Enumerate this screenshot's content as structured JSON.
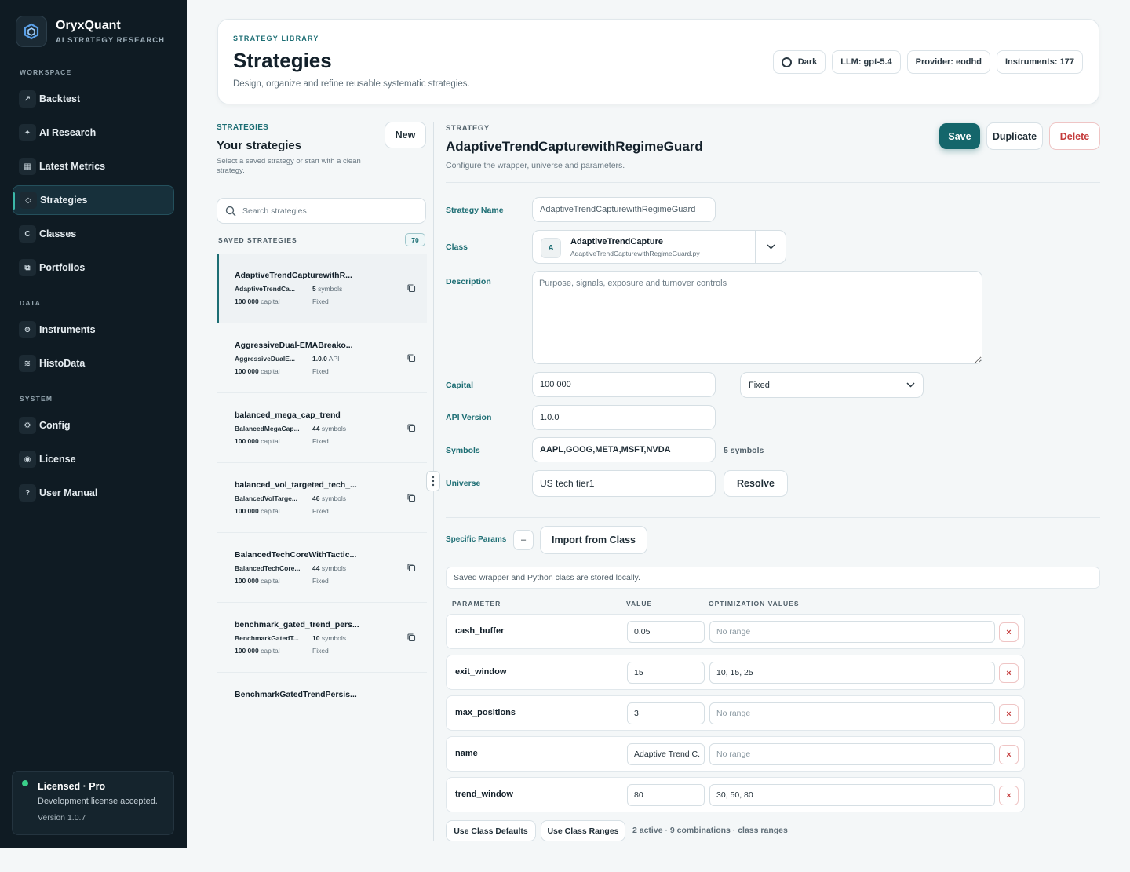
{
  "brand": {
    "name": "OryxQuant",
    "subtitle": "AI STRATEGY RESEARCH"
  },
  "sidebar": {
    "sections": {
      "workspace": "WORKSPACE",
      "data": "DATA",
      "system": "SYSTEM"
    },
    "items": [
      {
        "label": "Backtest",
        "icon": "trend-arrow-icon"
      },
      {
        "label": "AI Research",
        "icon": "sparkle-icon"
      },
      {
        "label": "Latest Metrics",
        "icon": "grid-icon"
      },
      {
        "label": "Strategies",
        "icon": "diamond-icon",
        "active": true
      },
      {
        "label": "Classes",
        "icon": "class-c-icon"
      },
      {
        "label": "Portfolios",
        "icon": "portfolio-icon"
      },
      {
        "label": "Instruments",
        "icon": "instrument-icon"
      },
      {
        "label": "HistoData",
        "icon": "wave-icon"
      },
      {
        "label": "Config",
        "icon": "gear-icon"
      },
      {
        "label": "License",
        "icon": "license-icon"
      },
      {
        "label": "User Manual",
        "icon": "question-icon"
      }
    ],
    "license": {
      "title": "Licensed · Pro",
      "desc": "Development license accepted.",
      "version": "Version 1.0.7",
      "status_color": "#3ad08a"
    }
  },
  "header": {
    "eyebrow": "STRATEGY LIBRARY",
    "title": "Strategies",
    "subtitle": "Design, organize and refine reusable systematic strategies.",
    "chips": {
      "theme": "Dark",
      "llm": "LLM: gpt-5.4",
      "provider": "Provider: eodhd",
      "instruments": "Instruments: 177"
    }
  },
  "list": {
    "eyebrow": "STRATEGIES",
    "title": "Your strategies",
    "desc": "Select a saved strategy or start with a clean strategy.",
    "new_label": "New",
    "search_placeholder": "Search strategies",
    "saved_label": "SAVED STRATEGIES",
    "saved_count": "70",
    "items": [
      {
        "name": "AdaptiveTrendCapturewithR...",
        "cls": "AdaptiveTrendCa...",
        "meta_b": "5",
        "meta": " symbols",
        "capital": "100 000",
        "capital_label": " capital",
        "mode": "Fixed"
      },
      {
        "name": "AggressiveDual-EMABreako...",
        "cls": "AggressiveDualE...",
        "meta_b": "1.0.0",
        "meta": " API",
        "capital": "100 000",
        "capital_label": " capital",
        "mode": "Fixed"
      },
      {
        "name": "balanced_mega_cap_trend",
        "cls": "BalancedMegaCap...",
        "meta_b": "44",
        "meta": " symbols",
        "capital": "100 000",
        "capital_label": " capital",
        "mode": "Fixed"
      },
      {
        "name": "balanced_vol_targeted_tech_...",
        "cls": "BalancedVolTarge...",
        "meta_b": "46",
        "meta": " symbols",
        "capital": "100 000",
        "capital_label": " capital",
        "mode": "Fixed"
      },
      {
        "name": "BalancedTechCoreWithTactic...",
        "cls": "BalancedTechCore...",
        "meta_b": "44",
        "meta": " symbols",
        "capital": "100 000",
        "capital_label": " capital",
        "mode": "Fixed"
      },
      {
        "name": "benchmark_gated_trend_pers...",
        "cls": "BenchmarkGatedT...",
        "meta_b": "10",
        "meta": " symbols",
        "capital": "100 000",
        "capital_label": " capital",
        "mode": "Fixed"
      }
    ],
    "last_item": "BenchmarkGatedTrendPersis..."
  },
  "detail": {
    "eyebrow": "STRATEGY",
    "title": "AdaptiveTrendCapturewithRegimeGuard",
    "subtitle": "Configure the wrapper, universe and parameters.",
    "save": "Save",
    "duplicate": "Duplicate",
    "delete": "Delete",
    "labels": {
      "name": "Strategy Name",
      "class": "Class",
      "description": "Description",
      "capital": "Capital",
      "api": "API Version",
      "symbols": "Symbols",
      "universe": "Universe",
      "params": "Specific Params"
    },
    "name_value": "AdaptiveTrendCapturewithRegimeGuard",
    "class_badge": "A",
    "class_name": "AdaptiveTrendCapture",
    "class_file": "AdaptiveTrendCapturewithRegimeGuard.py",
    "description_placeholder": "Purpose, signals, exposure and turnover controls",
    "capital_value": "100 000",
    "capital_mode": "Fixed",
    "api_value": "1.0.0",
    "symbols_value": "AAPL,GOOG,META,MSFT,NVDA",
    "symbols_count": "5 symbols",
    "universe_value": "US tech tier1",
    "resolve": "Resolve",
    "params_toggle": "–",
    "import": "Import from Class",
    "note": "Saved wrapper and Python class are stored locally.",
    "columns": {
      "param": "PARAMETER",
      "value": "VALUE",
      "opt": "OPTIMIZATION VALUES"
    },
    "params": [
      {
        "name": "cash_buffer",
        "value": "0.05",
        "opt": "No range",
        "empty": true
      },
      {
        "name": "exit_window",
        "value": "15",
        "opt": "10, 15, 25",
        "empty": false
      },
      {
        "name": "max_positions",
        "value": "3",
        "opt": "No range",
        "empty": true
      },
      {
        "name": "name",
        "value": "Adaptive Trend C.",
        "opt": "No range",
        "empty": true
      },
      {
        "name": "trend_window",
        "value": "80",
        "opt": "30, 50, 80",
        "empty": false
      }
    ],
    "remove_label": "×",
    "use_defaults": "Use Class Defaults",
    "use_ranges": "Use Class Ranges",
    "summary": "2 active · 9 combinations · class ranges"
  },
  "colors": {
    "accent": "#1d6e74",
    "save": "#14666b",
    "danger": "#c43b3b",
    "sidebar": "#0f1b23"
  }
}
